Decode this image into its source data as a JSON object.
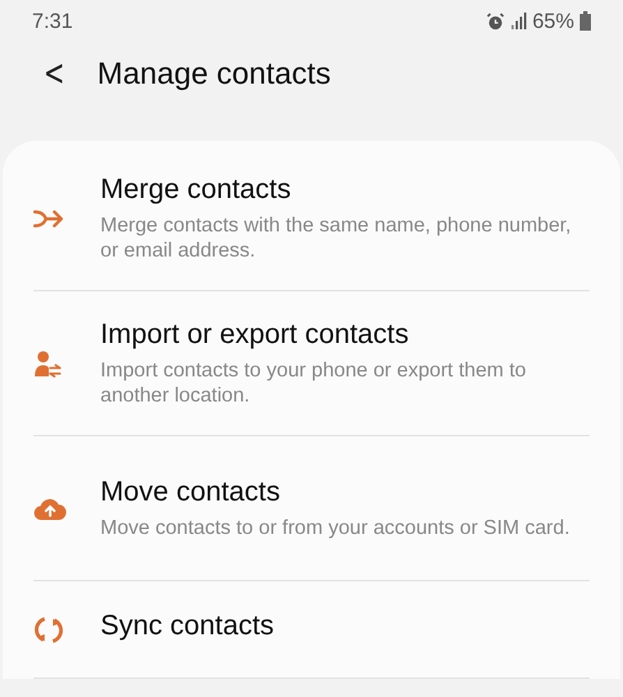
{
  "status_bar": {
    "time": "7:31",
    "battery": "65%"
  },
  "header": {
    "back": "<",
    "title": "Manage contacts"
  },
  "items": [
    {
      "kind": "merge",
      "title": "Merge contacts",
      "subtitle": "Merge contacts with the same name, phone number, or email address."
    },
    {
      "kind": "import-export",
      "title": "Import or export contacts",
      "subtitle": "Import contacts to your phone or export them to another location."
    },
    {
      "kind": "move",
      "title": "Move contacts",
      "subtitle": "Move contacts to or from your accounts or SIM card."
    },
    {
      "kind": "sync",
      "title": "Sync contacts"
    }
  ]
}
